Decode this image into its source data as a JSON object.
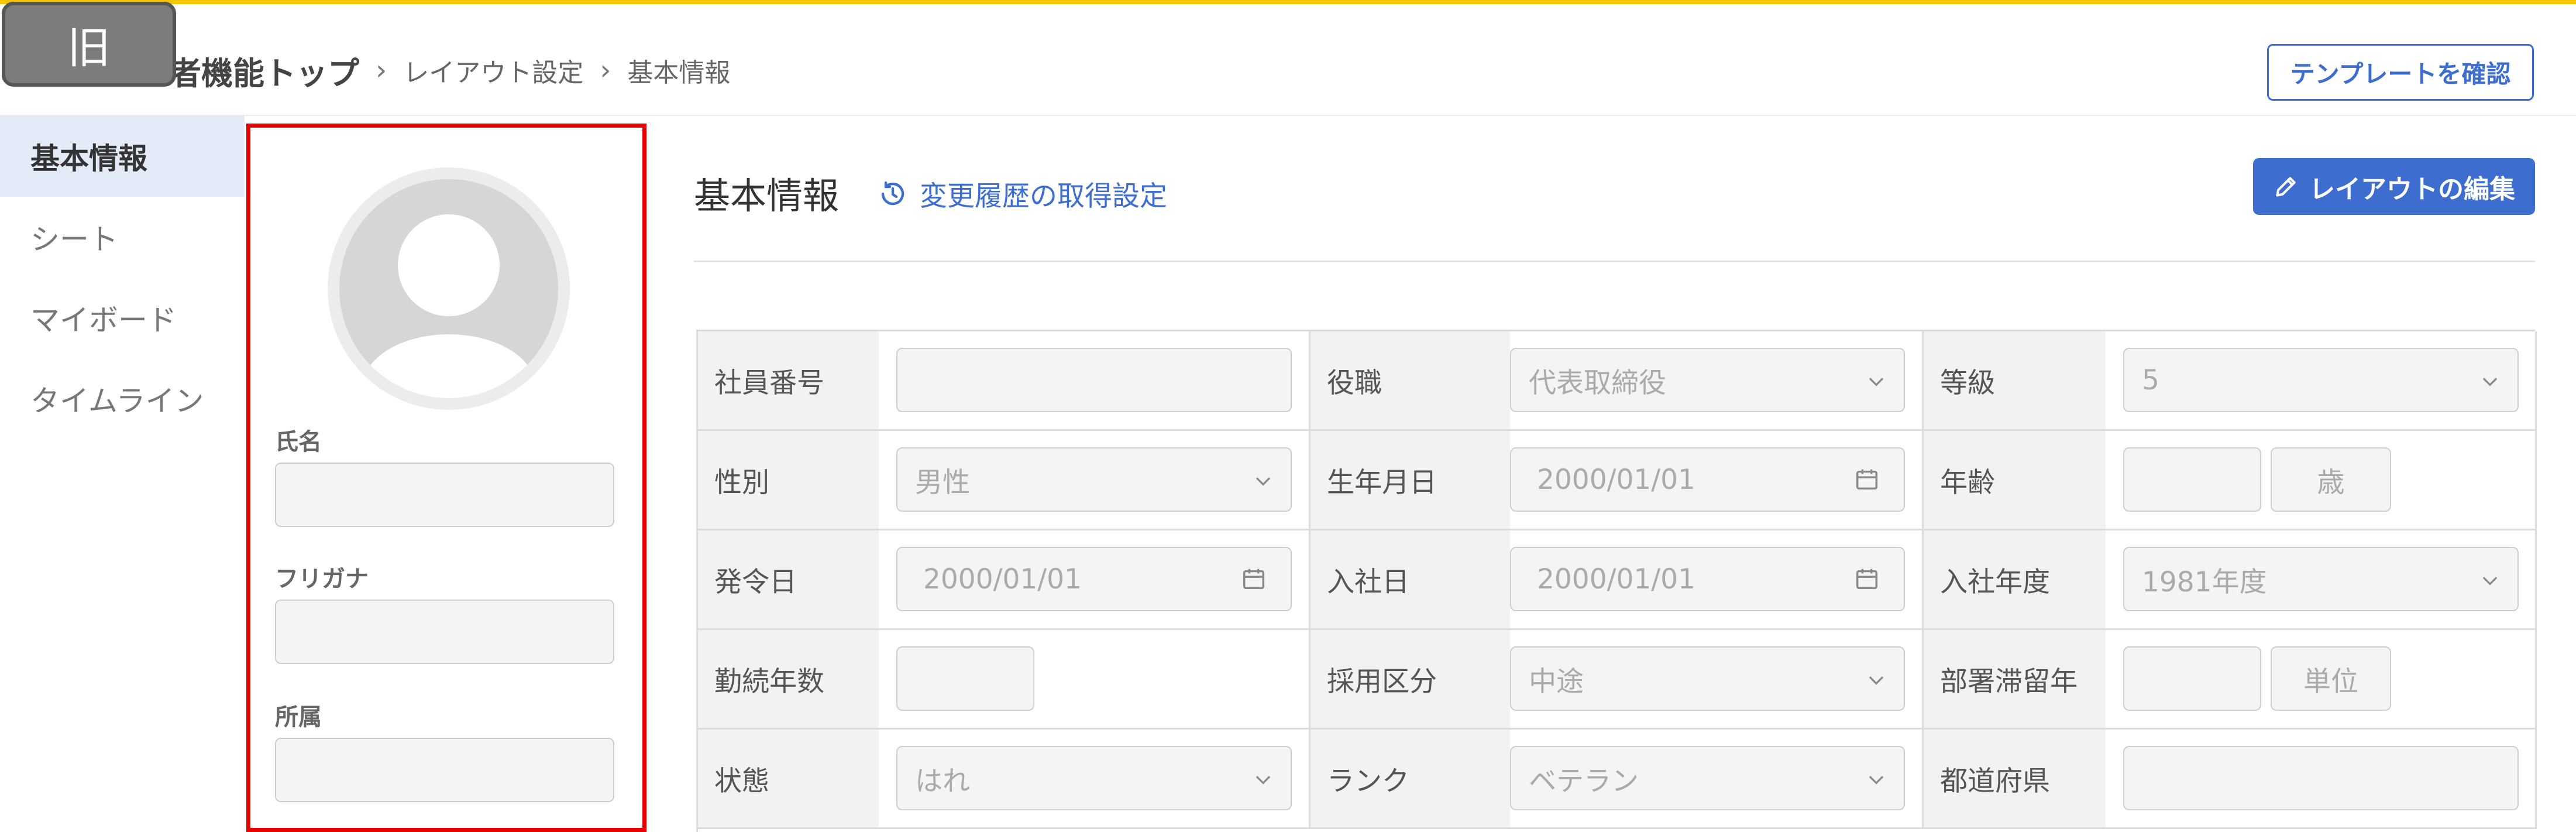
{
  "badge": "旧",
  "breadcrumb": {
    "root": "者機能トップ",
    "sep": "›",
    "level2": "レイアウト設定",
    "level3": "基本情報"
  },
  "header": {
    "template_button": "テンプレートを確認"
  },
  "sidebar": {
    "items": [
      {
        "label": "基本情報",
        "active": true
      },
      {
        "label": "シート"
      },
      {
        "label": "マイボード"
      },
      {
        "label": "タイムライン"
      }
    ]
  },
  "profile": {
    "name_label": "氏名",
    "kana_label": "フリガナ",
    "dept_label": "所属"
  },
  "main": {
    "title": "基本情報",
    "history_link": "変更履歴の取得設定",
    "edit_button": "レイアウトの編集"
  },
  "form": {
    "r1": {
      "c1_label": "社員番号",
      "c1_value": "",
      "c2_label": "役職",
      "c2_value": "代表取締役",
      "c3_label": "等級",
      "c3_value": "5"
    },
    "r2": {
      "c1_label": "性別",
      "c1_value": "男性",
      "c2_label": "生年月日",
      "c2_value": "2000/01/01",
      "c3_label": "年齢",
      "c3_value": "",
      "c3_unit": "歳"
    },
    "r3": {
      "c1_label": "発令日",
      "c1_value": "2000/01/01",
      "c2_label": "入社日",
      "c2_value": "2000/01/01",
      "c3_label": "入社年度",
      "c3_value": "1981年度"
    },
    "r4": {
      "c1_label": "勤続年数",
      "c1_value": "",
      "c2_label": "採用区分",
      "c2_value": "中途",
      "c3_label": "部署滞留年",
      "c3_value": "",
      "c3_unit": "単位"
    },
    "r5": {
      "c1_label": "状態",
      "c1_value": "はれ",
      "c2_label": "ランク",
      "c2_value": "ベテラン",
      "c3_label": "都道府県",
      "c3_value": ""
    }
  },
  "colors": {
    "accent": "#3d6ecf",
    "topline": "#f5c500",
    "highlight_border": "#e60000"
  }
}
